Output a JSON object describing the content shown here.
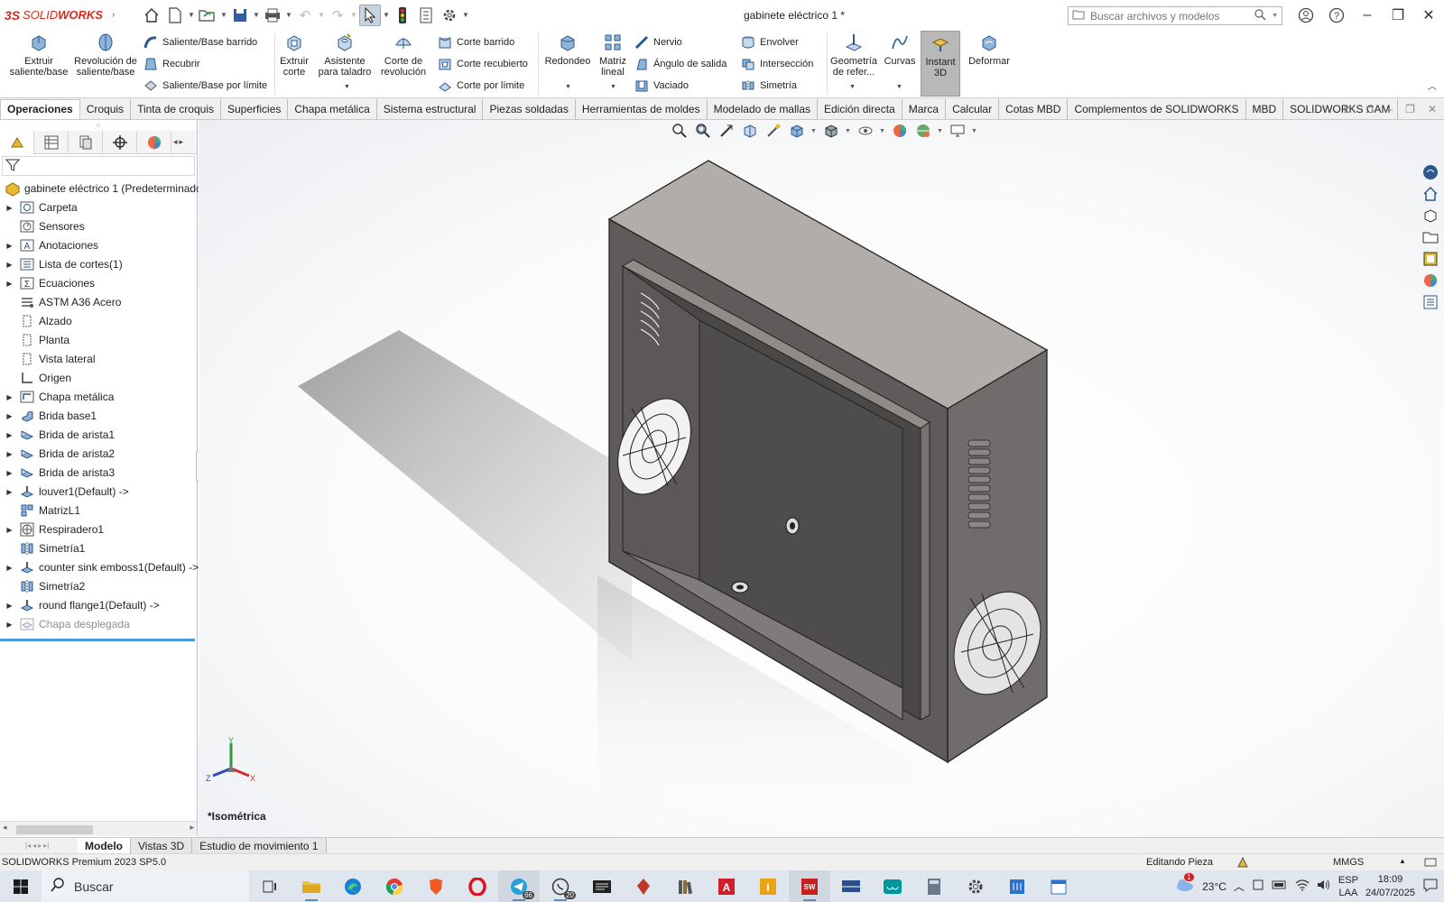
{
  "app": {
    "brand_prefix": "3S",
    "brand_name_1": "SOLID",
    "brand_name_2": "WORKS",
    "title": "gabinete eléctrico 1 *"
  },
  "search": {
    "placeholder": "Buscar archivos y modelos"
  },
  "ribbon": {
    "extrude_boss": "Extruir saliente/base",
    "revolve_boss": "Revolución de saliente/base",
    "swept_boss": "Saliente/Base barrido",
    "loft": "Recubrir",
    "boundary_boss": "Saliente/Base por límite",
    "extrude_cut": "Extruir corte",
    "hole_wizard": "Asistente para taladro",
    "revolve_cut": "Corte de revolución",
    "swept_cut": "Corte barrido",
    "lofted_cut": "Corte recubierto",
    "boundary_cut": "Corte por límite",
    "fillet": "Redondeo",
    "linear_pattern": "Matriz lineal",
    "rib": "Nervio",
    "draft": "Ángulo de salida",
    "shell": "Vaciado",
    "wrap": "Envolver",
    "intersect": "Intersección",
    "mirror": "Simetría",
    "ref_geometry": "Geometría de refer...",
    "curves": "Curvas",
    "instant3d": "Instant 3D",
    "deform": "Deformar"
  },
  "tabs": [
    "Operaciones",
    "Croquis",
    "Tinta de croquis",
    "Superficies",
    "Chapa metálica",
    "Sistema estructural",
    "Piezas soldadas",
    "Herramientas de moldes",
    "Modelado de mallas",
    "Edición directa",
    "Marca",
    "Calcular",
    "Cotas MBD",
    "Complementos de SOLIDWORKS",
    "MBD",
    "SOLIDWORKS CAM"
  ],
  "tree": {
    "root": "gabinete eléctrico 1 (Predeterminado)",
    "items": [
      "Carpeta",
      "Sensores",
      "Anotaciones",
      "Lista de cortes(1)",
      "Ecuaciones",
      "ASTM A36 Acero",
      "Alzado",
      "Planta",
      "Vista lateral",
      "Origen",
      "Chapa metálica",
      "Brida base1",
      "Brida de arista1",
      "Brida de arista2",
      "Brida de arista3",
      "louver1(Default) ->",
      "MatrizL1",
      "Respiradero1",
      "Simetría1",
      "counter sink emboss1(Default) ->",
      "Simetría2",
      "round flange1(Default) ->",
      "Chapa desplegada"
    ]
  },
  "viewport": {
    "view_name": "*Isométrica",
    "axis_x": "X",
    "axis_y": "Y",
    "axis_z": "Z"
  },
  "bottom_tabs": [
    "Modelo",
    "Vistas 3D",
    "Estudio de movimiento 1"
  ],
  "status": {
    "version": "SOLIDWORKS Premium 2023 SP5.0",
    "mode": "Editando Pieza",
    "units": "MMGS"
  },
  "taskbar": {
    "search": "Buscar",
    "temperature": "23°C",
    "lang1": "ESP",
    "lang2": "LAA",
    "time": "18:09",
    "date": "24/07/2025",
    "telegram_badge": "66",
    "whatsapp_badge": "20",
    "weather_badge": "1"
  }
}
